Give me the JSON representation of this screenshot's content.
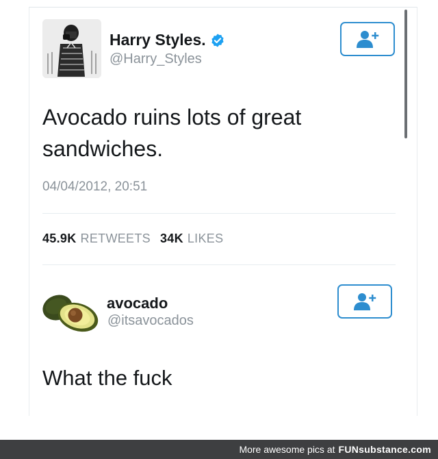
{
  "tweet": {
    "author": {
      "name": "Harry Styles.",
      "handle": "@Harry_Styles",
      "verified": true,
      "avatar_icon": "profile-photo"
    },
    "text": "Avocado ruins lots of great sandwiches.",
    "timestamp": "04/04/2012, 20:51",
    "stats": {
      "retweets_count": "45.9K",
      "retweets_label": "RETWEETS",
      "likes_count": "34K",
      "likes_label": "LIKES"
    },
    "follow_icon": "add-user-icon"
  },
  "reply": {
    "author": {
      "name": "avocado",
      "handle": "@itsavocados",
      "avatar_icon": "avocado-image"
    },
    "text": "What the fuck",
    "follow_icon": "add-user-icon"
  },
  "footer": {
    "text": "More awesome pics at",
    "brand": "FUNsubstance.com"
  },
  "colors": {
    "accent": "#2d8dcf",
    "verified": "#1da1f2",
    "muted": "#8a9299",
    "footer_bg": "#3e3f41"
  }
}
